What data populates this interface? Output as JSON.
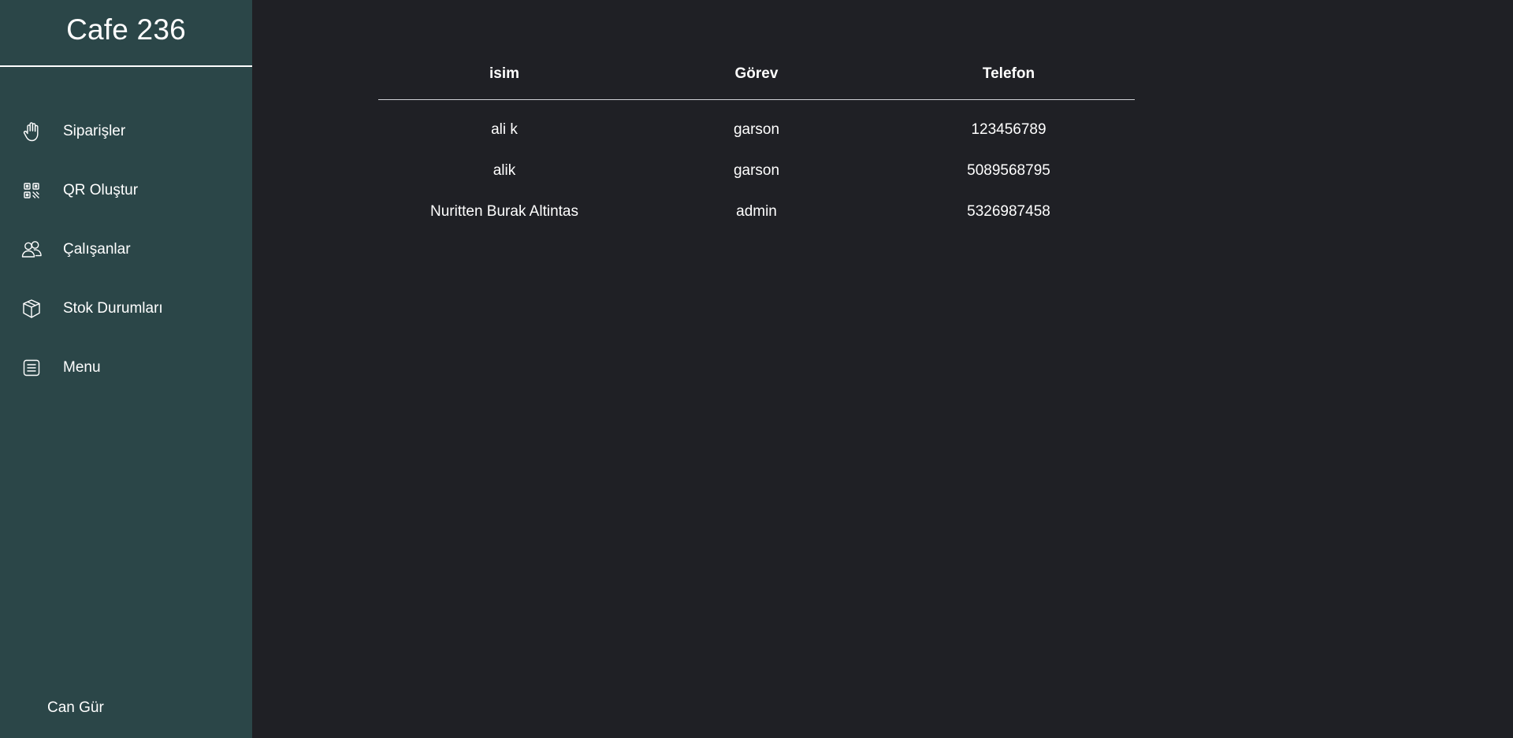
{
  "app": {
    "title": "Cafe 236"
  },
  "sidebar": {
    "items": [
      {
        "label": "Siparişler",
        "icon": "hand-icon"
      },
      {
        "label": "QR Oluştur",
        "icon": "qr-code-icon"
      },
      {
        "label": "Çalışanlar",
        "icon": "users-icon"
      },
      {
        "label": "Stok Durumları",
        "icon": "box-icon"
      },
      {
        "label": "Menu",
        "icon": "list-icon"
      }
    ],
    "user_name": "Can Gür"
  },
  "table": {
    "headers": [
      "isim",
      "Görev",
      "Telefon"
    ],
    "rows": [
      [
        "ali k",
        "garson",
        "123456789"
      ],
      [
        "alik",
        "garson",
        "5089568795"
      ],
      [
        "Nuritten Burak Altintas",
        "admin",
        "5326987458"
      ]
    ]
  },
  "colors": {
    "sidebar_bg": "#2b4648",
    "main_bg": "#1f2025",
    "text": "#ffffff"
  }
}
